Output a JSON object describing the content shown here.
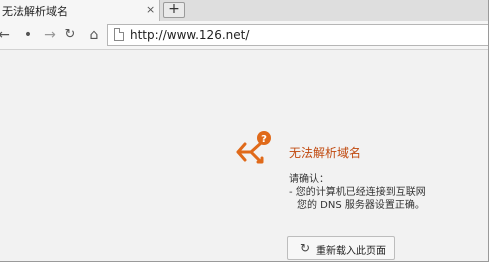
{
  "tab": {
    "title": "无法解析域名",
    "close": "×"
  },
  "new_tab": "+",
  "toolbar": {
    "back": "←",
    "forward": "•",
    "forward_arrow": "→",
    "reload": "↻",
    "home": "⌂",
    "url": "http://www.126.net/"
  },
  "error": {
    "title": "无法解析域名",
    "hint_title": "请确认：",
    "hint_lines": [
      "- 您的计算机已经连接到互联网",
      "  您的 DNS 服务器设置正确。"
    ],
    "retry_label": "重新载入此页面",
    "retry_icon": "↻"
  },
  "colors": {
    "accent": "#c0490e",
    "icon": "#e06a1a"
  }
}
